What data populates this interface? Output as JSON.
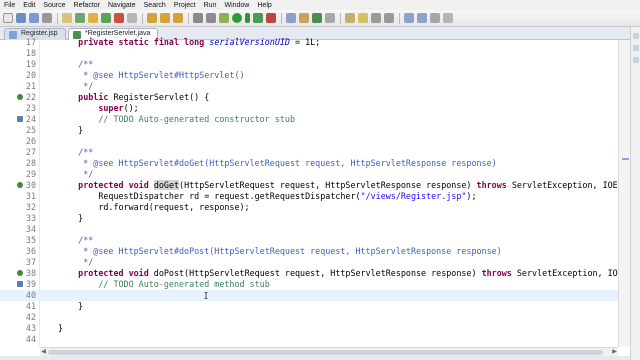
{
  "menu": [
    "File",
    "Edit",
    "Source",
    "Refactor",
    "Navigate",
    "Search",
    "Project",
    "Run",
    "Window",
    "Help"
  ],
  "tabs": [
    {
      "label": "Register.jsp",
      "icon": "jsp-file-icon"
    },
    {
      "label": "*RegisterServlet.java",
      "icon": "java-file-icon",
      "close": "✕"
    }
  ],
  "editor": {
    "lines": [
      {
        "n": "17",
        "segments": [
          {
            "t": "    "
          },
          {
            "t": "private static final long",
            "c": "kw"
          },
          {
            "t": " "
          },
          {
            "t": "serialVersionUID",
            "c": "fd"
          },
          {
            "t": " = 1L;"
          }
        ]
      },
      {
        "n": "18",
        "segments": [
          {
            "t": ""
          }
        ]
      },
      {
        "n": "19",
        "segments": [
          {
            "t": "    /**",
            "c": "cm"
          }
        ]
      },
      {
        "n": "20",
        "segments": [
          {
            "t": "     * @see HttpServlet#HttpServlet()",
            "c": "cm"
          }
        ]
      },
      {
        "n": "21",
        "segments": [
          {
            "t": "     */",
            "c": "cm"
          }
        ]
      },
      {
        "n": "22",
        "segments": [
          {
            "t": "    "
          },
          {
            "t": "public",
            "c": "kw"
          },
          {
            "t": " RegisterServlet() {"
          }
        ]
      },
      {
        "n": "23",
        "segments": [
          {
            "t": "        "
          },
          {
            "t": "super",
            "c": "kw"
          },
          {
            "t": "();"
          }
        ]
      },
      {
        "n": "24",
        "segments": [
          {
            "t": "        // TODO Auto-generated constructor stub",
            "c": "lc"
          }
        ]
      },
      {
        "n": "25",
        "segments": [
          {
            "t": "    }"
          }
        ]
      },
      {
        "n": "26",
        "segments": [
          {
            "t": ""
          }
        ]
      },
      {
        "n": "27",
        "segments": [
          {
            "t": "    /**",
            "c": "cm"
          }
        ]
      },
      {
        "n": "28",
        "segments": [
          {
            "t": "     * @see HttpServlet#doGet(HttpServletRequest request, HttpServletResponse response)",
            "c": "cm"
          }
        ]
      },
      {
        "n": "29",
        "segments": [
          {
            "t": "     */",
            "c": "cm"
          }
        ]
      },
      {
        "n": "30",
        "segments": [
          {
            "t": "    "
          },
          {
            "t": "protected void",
            "c": "kw"
          },
          {
            "t": " "
          },
          {
            "t": "doGet",
            "c": "hl"
          },
          {
            "t": "(HttpServletRequest request, HttpServletResponse response) "
          },
          {
            "t": "throws",
            "c": "kw"
          },
          {
            "t": " ServletException, IOExce"
          }
        ]
      },
      {
        "n": "31",
        "segments": [
          {
            "t": "        RequestDispatcher rd = request.getRequestDispatcher("
          },
          {
            "t": "\"/views/Register.jsp\"",
            "c": "st"
          },
          {
            "t": ");"
          }
        ]
      },
      {
        "n": "32",
        "segments": [
          {
            "t": "        rd.forward(request, response);"
          }
        ]
      },
      {
        "n": "33",
        "segments": [
          {
            "t": "    }"
          }
        ]
      },
      {
        "n": "34",
        "segments": [
          {
            "t": ""
          }
        ]
      },
      {
        "n": "35",
        "segments": [
          {
            "t": "    /**",
            "c": "cm"
          }
        ]
      },
      {
        "n": "36",
        "segments": [
          {
            "t": "     * @see HttpServlet#doPost(HttpServletRequest request, HttpServletResponse response)",
            "c": "cm"
          }
        ]
      },
      {
        "n": "37",
        "segments": [
          {
            "t": "     */",
            "c": "cm"
          }
        ]
      },
      {
        "n": "38",
        "segments": [
          {
            "t": "    "
          },
          {
            "t": "protected void",
            "c": "kw"
          },
          {
            "t": " doPost(HttpServletRequest request, HttpServletResponse response) "
          },
          {
            "t": "throws",
            "c": "kw"
          },
          {
            "t": " ServletException, IOExce"
          }
        ]
      },
      {
        "n": "39",
        "segments": [
          {
            "t": "        // TODO Auto-generated method stub",
            "c": "lc"
          }
        ]
      },
      {
        "n": "40",
        "segments": [
          {
            "t": ""
          }
        ],
        "current": true
      },
      {
        "n": "41",
        "segments": [
          {
            "t": "    }"
          }
        ]
      },
      {
        "n": "42",
        "segments": [
          {
            "t": ""
          }
        ]
      },
      {
        "n": "43",
        "segments": [
          {
            "t": "}"
          }
        ]
      },
      {
        "n": "44",
        "segments": [
          {
            "t": ""
          }
        ]
      }
    ]
  },
  "colors": {
    "keyword": "#7f0055",
    "javadoc": "#3f5fbf",
    "line_comment": "#3f7f5f",
    "string": "#2a00ff",
    "field": "#0000c0",
    "current_line": "#e8f2fe"
  }
}
